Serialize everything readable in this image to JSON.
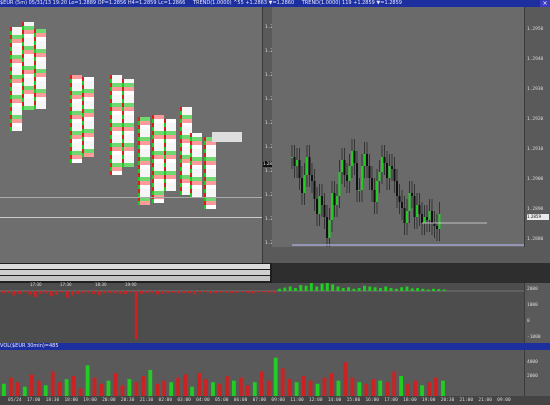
{
  "app": {
    "price_bar_title": "$EUR (5m) 05/31/13 19:20 Lo=1.2889 OP=1.2856 H4=1.2859 Lc=1.2866",
    "trend_title": "TREND(1.0000) ^55 +1.2863 ▼=1.2860",
    "trend_title2": "TREND(1.0000) 119 +1.2859 ▼=1.2859",
    "volume_title": "VOL($EUR 30min)=485"
  },
  "chart_data": {
    "type": "bar",
    "price_ticks_left": [
      "1.2895",
      "1.2890",
      "1.2885",
      "1.2880",
      "1.2875",
      "1.2870",
      "1.2865",
      "1.2860",
      "1.2855",
      "1.2850"
    ],
    "price_ticks_right": [
      "1.2950",
      "1.2940",
      "1.2930",
      "1.2920",
      "1.2910",
      "1.2900",
      "1.2890",
      "1.2880"
    ],
    "current_price_left": "1.2867",
    "current_price_right": "1.2859",
    "delta_ticks": [
      "2000",
      "1000",
      "0",
      "-1000"
    ],
    "volume_ticks": [
      "4000",
      "2000"
    ],
    "time_labels_left": [
      "17:30",
      "17:30",
      "18:30",
      "19:00"
    ],
    "time_labels_bottom": [
      "05/24",
      "17:00",
      "18:30",
      "18:00",
      "19:00",
      "20:00",
      "20:30",
      "21:30",
      "02:00",
      "03:00",
      "04:00",
      "05:00",
      "06:00",
      "07:00",
      "09:00",
      "11:00",
      "12:00",
      "14:00",
      "15:00",
      "16:00",
      "17:00",
      "18:00",
      "19:00",
      "20:30",
      "21:00",
      "21:00",
      "09:00"
    ],
    "time_labels_right": [
      "16:30",
      "21:00",
      "09:00"
    ],
    "price_series": [
      1.2905,
      1.2902,
      1.2904,
      1.2898,
      1.2893,
      1.2899,
      1.2905,
      1.2899,
      1.2897,
      1.2891,
      1.2886,
      1.2892,
      1.2889,
      1.2885,
      1.2878,
      1.2884,
      1.2893,
      1.2889,
      1.2892,
      1.29,
      1.2904,
      1.2899,
      1.2897,
      1.2902,
      1.2907,
      1.2903,
      1.2894,
      1.2894,
      1.2902,
      1.2906,
      1.2902,
      1.2898,
      1.2894,
      1.289,
      1.2897,
      1.29,
      1.2905,
      1.2903,
      1.2898,
      1.2902,
      1.2901,
      1.2897,
      1.2892,
      1.289,
      1.2888,
      1.2883,
      1.2887,
      1.2893,
      1.2892,
      1.2885,
      1.2889,
      1.2886,
      1.2883,
      1.2885,
      1.2884,
      1.2887,
      1.2883,
      1.2882,
      1.2881,
      1.2886
    ],
    "delta_values": [
      -30,
      -25,
      -60,
      -40,
      -20,
      -50,
      -80,
      -40,
      -30,
      -70,
      -50,
      -20,
      -90,
      -60,
      -40,
      -30,
      -20,
      -40,
      -55,
      -35,
      -25,
      -30,
      -45,
      -40,
      -20,
      -650,
      -35,
      -30,
      -25,
      -45,
      -40,
      -30,
      -20,
      -35,
      -25,
      -30,
      -45,
      -20,
      -15,
      -35,
      -30,
      -20,
      -25,
      -30,
      -20,
      -15,
      -25,
      -35,
      -20,
      -15,
      -25,
      -30,
      30,
      45,
      60,
      40,
      80,
      70,
      120,
      60,
      100,
      210,
      90,
      60,
      40,
      50,
      30,
      40,
      70,
      60,
      50,
      40,
      60,
      40,
      30,
      50,
      60,
      35,
      40,
      30,
      20,
      30,
      25,
      20
    ],
    "volume_values": [
      800,
      1200,
      900,
      600,
      1400,
      1000,
      700,
      1600,
      900,
      1100,
      1300,
      500,
      2000,
      1200,
      800,
      1000,
      1500,
      700,
      1100,
      900,
      1300,
      1700,
      800,
      1000,
      900,
      1200,
      1400,
      600,
      1500,
      1100,
      900,
      800,
      1300,
      1000,
      1200,
      700,
      900,
      1600,
      1000,
      2500,
      1800,
      1100,
      900,
      1300,
      1000,
      800,
      1200,
      1500,
      1000,
      2200,
      1200,
      900,
      800,
      1100,
      1000,
      900,
      1600,
      1300,
      800,
      1000,
      700,
      900,
      1200,
      1000
    ]
  },
  "colors": {
    "up": "#22cc22",
    "down": "#cc2222",
    "bar_title": "#1d2f9e",
    "panel": "#6e6e6e"
  }
}
